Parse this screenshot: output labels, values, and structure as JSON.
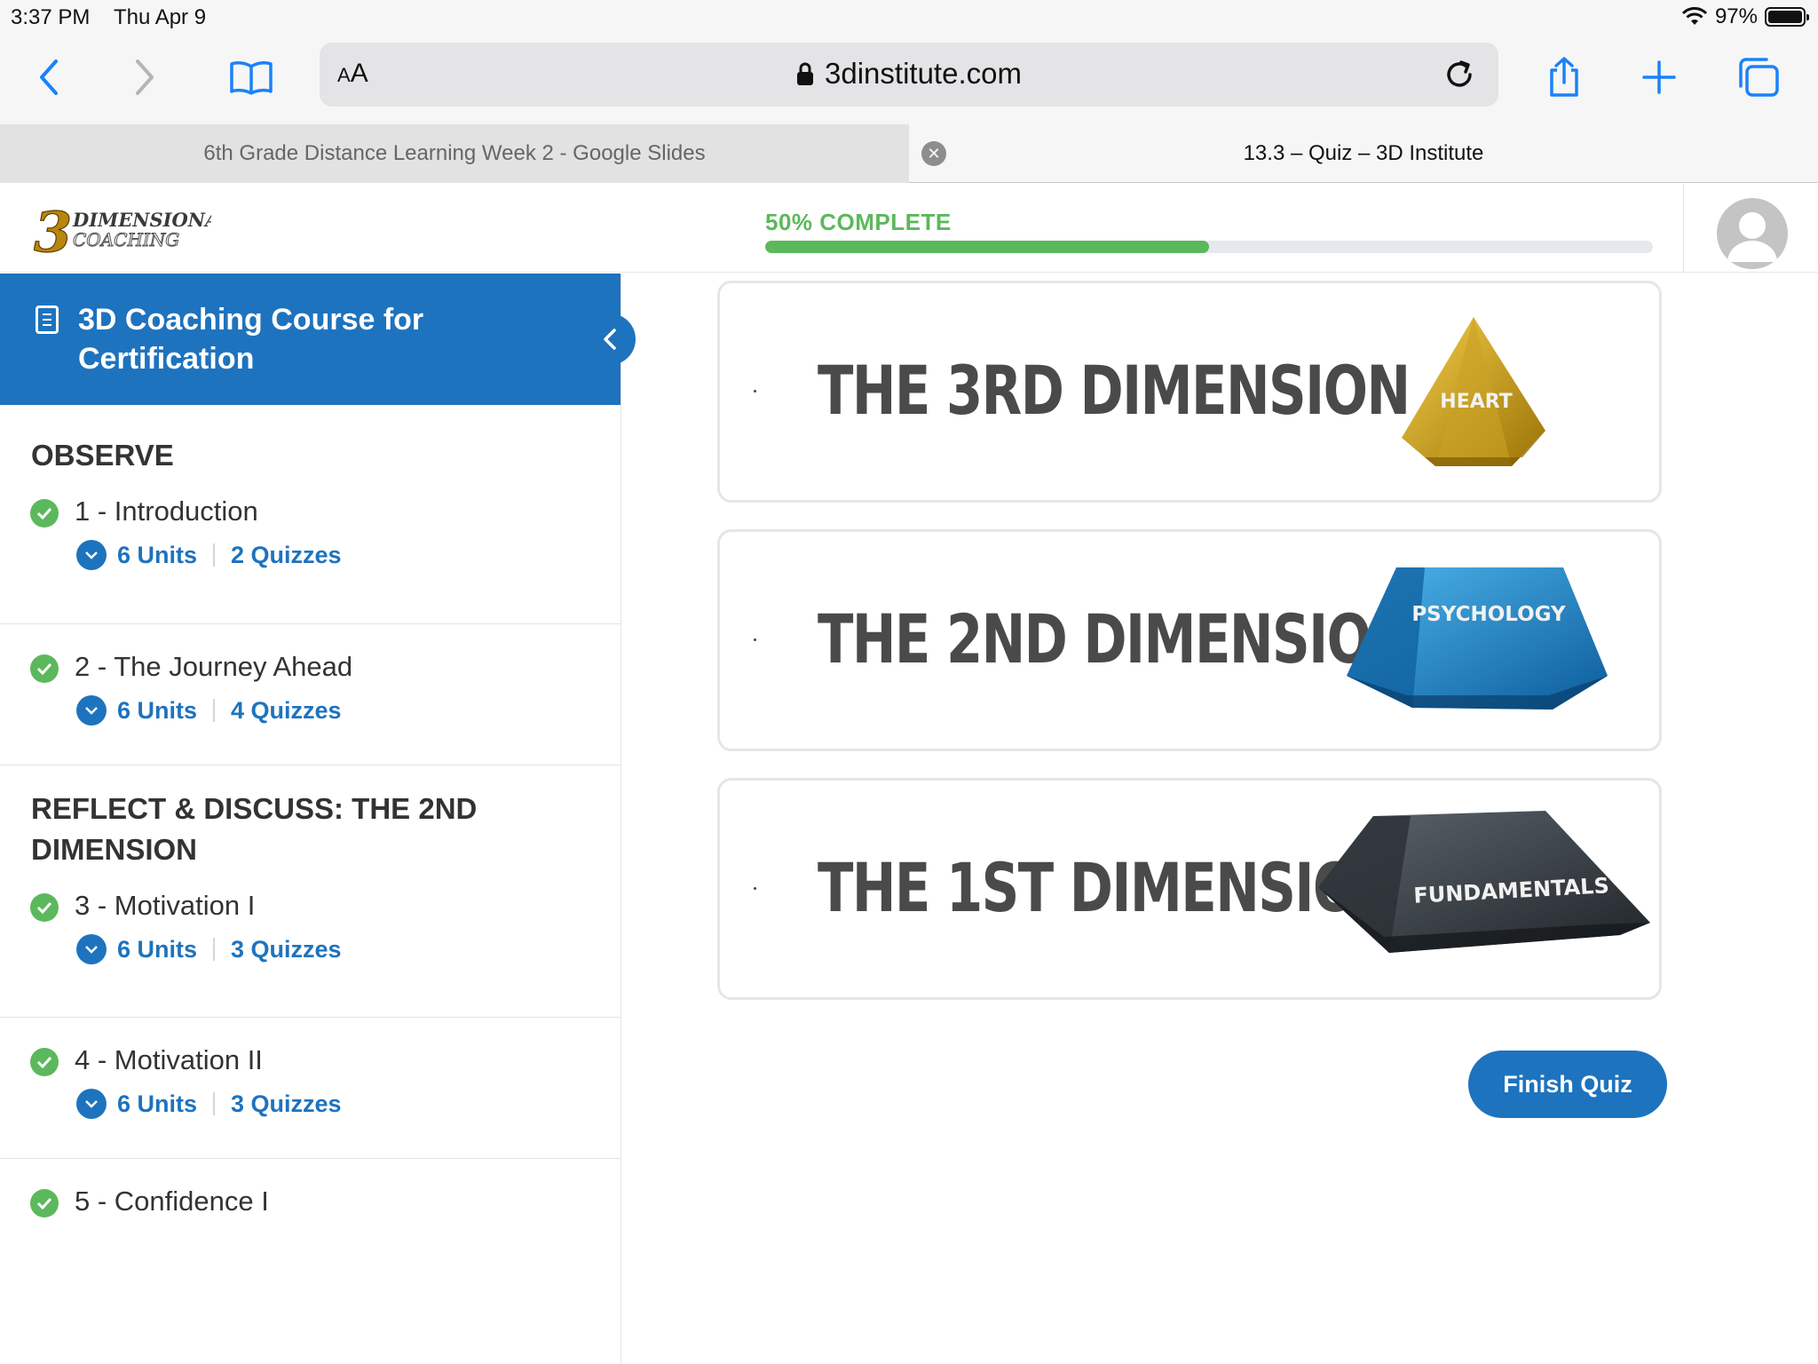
{
  "status_bar": {
    "time": "3:37 PM",
    "date": "Thu Apr 9",
    "battery": "97%"
  },
  "browser": {
    "aa_label": "AA",
    "url": "3dinstitute.com",
    "tabs": [
      {
        "label": "6th Grade Distance Learning Week 2 - Google Slides",
        "active": false
      },
      {
        "label": "13.3 – Quiz – 3D Institute",
        "active": true
      }
    ]
  },
  "header": {
    "logo_top": "DIMENSIONAL",
    "logo_bottom": "COACHING",
    "logo_number": "3",
    "progress_label": "50% COMPLETE",
    "progress_fraction": 0.5
  },
  "sidebar": {
    "course_title": "3D Coaching Course for Certification",
    "sections": [
      {
        "title": "OBSERVE",
        "lessons": [
          {
            "title": "1 - Introduction",
            "units": "6 Units",
            "quizzes": "2 Quizzes"
          },
          {
            "title": "2 - The Journey Ahead",
            "units": "6 Units",
            "quizzes": "4 Quizzes"
          }
        ]
      },
      {
        "title": "REFLECT & DISCUSS: THE 2ND DIMENSION",
        "lessons": [
          {
            "title": "3 - Motivation I",
            "units": "6 Units",
            "quizzes": "3 Quizzes"
          },
          {
            "title": "4 - Motivation II",
            "units": "6 Units",
            "quizzes": "3 Quizzes"
          },
          {
            "title": "5 - Confidence I"
          }
        ]
      }
    ]
  },
  "quiz": {
    "answers": [
      {
        "text": "THE 3RD DIMENSION",
        "gem_label": "HEART",
        "gem_color": "#d4a017"
      },
      {
        "text": "THE 2ND DIMENSION",
        "gem_label": "PSYCHOLOGY",
        "gem_color": "#1f8fd0"
      },
      {
        "text": "THE 1ST DIMENSION",
        "gem_label": "FUNDAMENTALS",
        "gem_color": "#3a3f44"
      }
    ],
    "finish_label": "Finish Quiz"
  },
  "colors": {
    "brand_blue": "#1e73be",
    "success_green": "#5cb85c",
    "ios_blue": "#1a82fb"
  }
}
